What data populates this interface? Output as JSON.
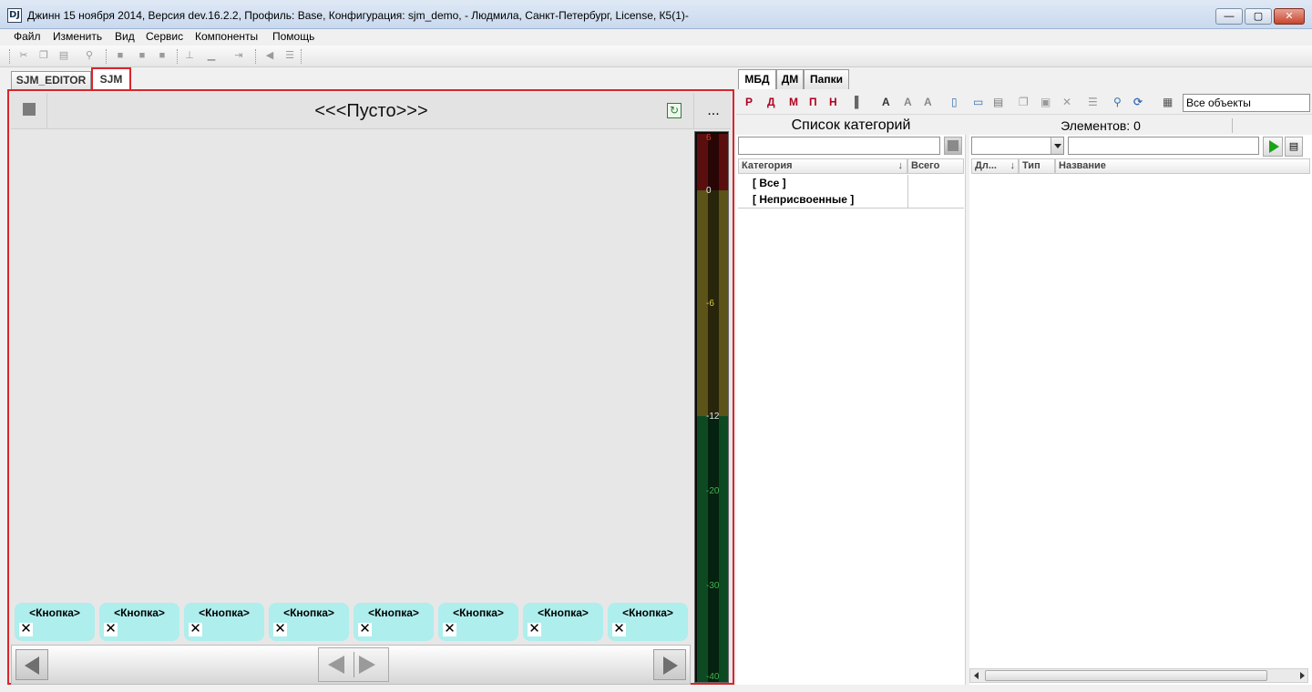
{
  "window": {
    "title": "Джинн 15 ноября 2014, Версия dev.16.2.2, Профиль: Base, Конфигурация: sjm_demo, - Людмила, Санкт-Петербург,  License, К5(1)-",
    "icon_text": "DJ",
    "min_label": "—",
    "max_label": "▢",
    "close_label": "✕"
  },
  "menu": [
    "Файл",
    "Изменить",
    "Вид",
    "Сервис",
    "Компоненты",
    "Помощь"
  ],
  "left_tabs": [
    {
      "label": "SJM_EDITOR",
      "active": false
    },
    {
      "label": "SJM",
      "active": true
    }
  ],
  "player": {
    "title": "<<<Пусто>>>",
    "more_label": "...",
    "refresh_icon": "↻",
    "meter_ticks": [
      "6",
      "0",
      "-6",
      "-12",
      "-20",
      "-30",
      "-40"
    ],
    "channel_buttons": [
      {
        "label": "<Кнопка>",
        "close": "✕"
      },
      {
        "label": "<Кнопка>",
        "close": "✕"
      },
      {
        "label": "<Кнопка>",
        "close": "✕"
      },
      {
        "label": "<Кнопка>",
        "close": "✕"
      },
      {
        "label": "<Кнопка>",
        "close": "✕"
      },
      {
        "label": "<Кнопка>",
        "close": "✕"
      },
      {
        "label": "<Кнопка>",
        "close": "✕"
      },
      {
        "label": "<Кнопка>",
        "close": "✕"
      }
    ]
  },
  "right_tabs": [
    {
      "label": "МБД",
      "active": true
    },
    {
      "label": "ДМ",
      "active": false
    },
    {
      "label": "Папки",
      "active": false
    }
  ],
  "right_toolbar": {
    "letter_buttons": [
      "Р",
      "Д",
      "М",
      "П",
      "Н"
    ],
    "font_buttons": [
      "A",
      "A",
      "A"
    ],
    "object_filter": "Все объекты"
  },
  "categories": {
    "header": "Список категорий",
    "columns": [
      "Категория",
      "Всего"
    ],
    "items": [
      "[ Все ]",
      "[ Неприсвоенные ]"
    ]
  },
  "elements": {
    "header": "Элементов: 0",
    "columns": [
      "Дл...",
      "Тип",
      "Название"
    ]
  },
  "colors": {
    "highlight_border": "#d7262c",
    "channel_button_bg": "#aeeeed",
    "play_green": "#1aa31a"
  }
}
